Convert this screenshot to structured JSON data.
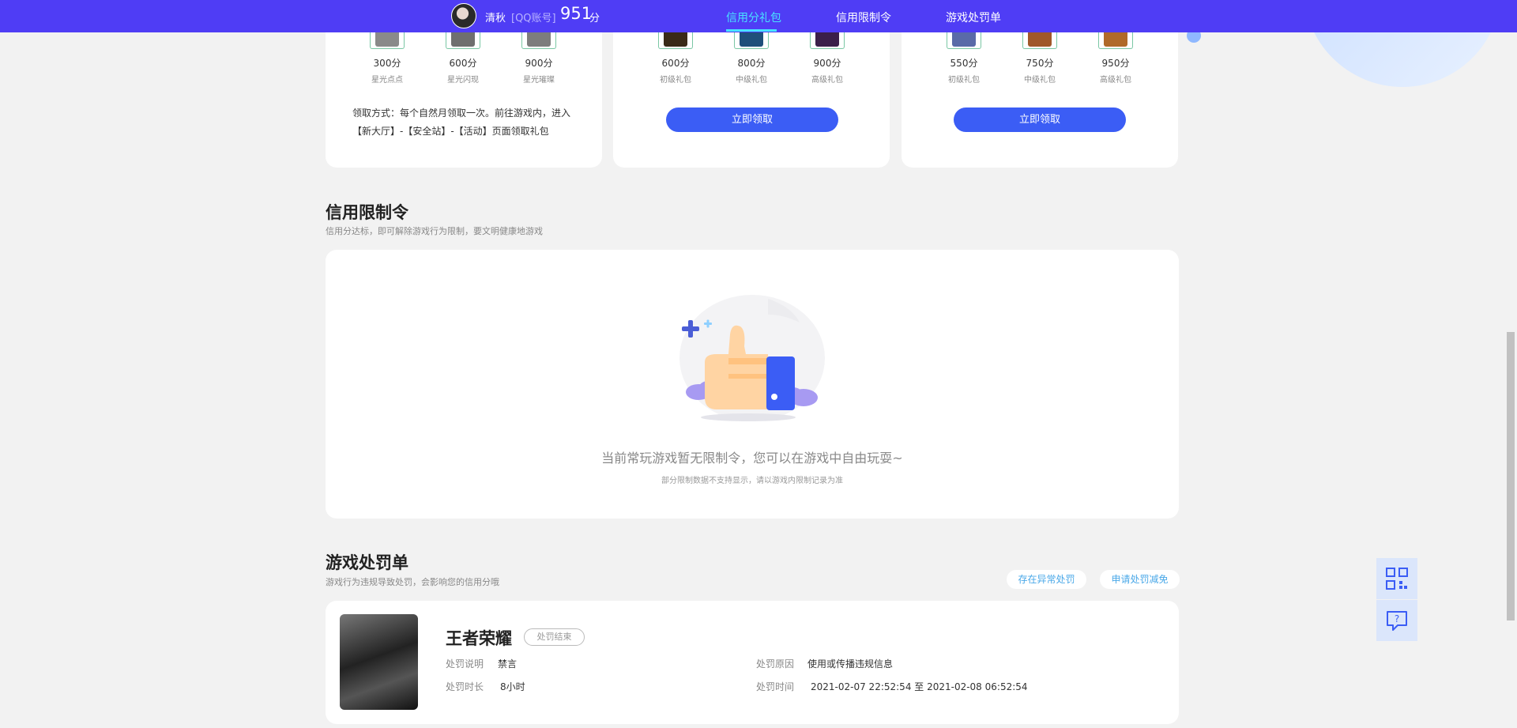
{
  "header": {
    "username": "清秋",
    "account_tag": "[QQ账号]",
    "score": "951",
    "score_unit": "分",
    "tabs": [
      {
        "label": "信用分礼包",
        "active": true
      },
      {
        "label": "信用限制令",
        "active": false
      },
      {
        "label": "游戏处罚单",
        "active": false
      }
    ]
  },
  "gift_cards": [
    {
      "prizes": [
        {
          "points": "300分",
          "name": "星光点点"
        },
        {
          "points": "600分",
          "name": "星光闪现"
        },
        {
          "points": "900分",
          "name": "星光璀璨"
        }
      ],
      "note": "领取方式：每个自然月领取一次。前往游戏内，进入【新大厅】-【安全站】-【活动】页面领取礼包"
    },
    {
      "prizes": [
        {
          "points": "600分",
          "name": "初级礼包"
        },
        {
          "points": "800分",
          "name": "中级礼包"
        },
        {
          "points": "900分",
          "name": "高级礼包"
        }
      ],
      "button": "立即领取"
    },
    {
      "prizes": [
        {
          "points": "550分",
          "name": "初级礼包"
        },
        {
          "points": "750分",
          "name": "中级礼包"
        },
        {
          "points": "950分",
          "name": "高级礼包"
        }
      ],
      "button": "立即领取"
    }
  ],
  "restriction": {
    "title": "信用限制令",
    "subtitle": "信用分达标，即可解除游戏行为限制，要文明健康地游戏",
    "empty_text": "当前常玩游戏暂无限制令，您可以在游戏中自由玩耍~",
    "empty_note": "部分限制数据不支持显示，请以游戏内限制记录为准"
  },
  "penalty": {
    "title": "游戏处罚单",
    "subtitle": "游戏行为违规导致处罚，会影响您的信用分哦",
    "buttons": [
      "存在异常处罚",
      "申请处罚减免"
    ],
    "record": {
      "game": "王者荣耀",
      "status": "处罚结束",
      "desc_label": "处罚说明",
      "desc_value": "禁言",
      "duration_label": "处罚时长",
      "duration_value": "8小时",
      "reason_label": "处罚原因",
      "reason_value": "使用或传播违规信息",
      "time_label": "处罚时间",
      "time_value": "2021-02-07 22:52:54 至 2021-02-08 06:52:54"
    }
  },
  "colors": {
    "topbar": "#4f3df5",
    "accent_tab": "#49e3ff",
    "button": "#3b5df5"
  }
}
